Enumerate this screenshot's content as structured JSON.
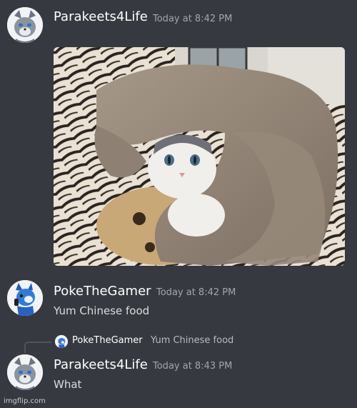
{
  "messages": [
    {
      "username": "Parakeets4Life",
      "timestamp": "Today at 8:42 PM",
      "avatar_icon": "gray-wolf-avatar"
    },
    {
      "username": "PokeTheGamer",
      "timestamp": "Today at 8:42 PM",
      "content": "Yum Chinese food",
      "avatar_icon": "blue-wolf-avatar"
    },
    {
      "username": "Parakeets4Life",
      "timestamp": "Today at 8:43 PM",
      "content": "What",
      "avatar_icon": "gray-wolf-avatar",
      "reply": {
        "username": "PokeTheGamer",
        "content": "Yum Chinese food"
      }
    }
  ],
  "attachment": {
    "description_icon": "cat-under-blanket-photo"
  },
  "watermark": "imgflip.com",
  "colors": {
    "background": "#36393f",
    "username": "#ffffff",
    "timestamp": "#a3a6aa",
    "text": "#dcddde"
  }
}
